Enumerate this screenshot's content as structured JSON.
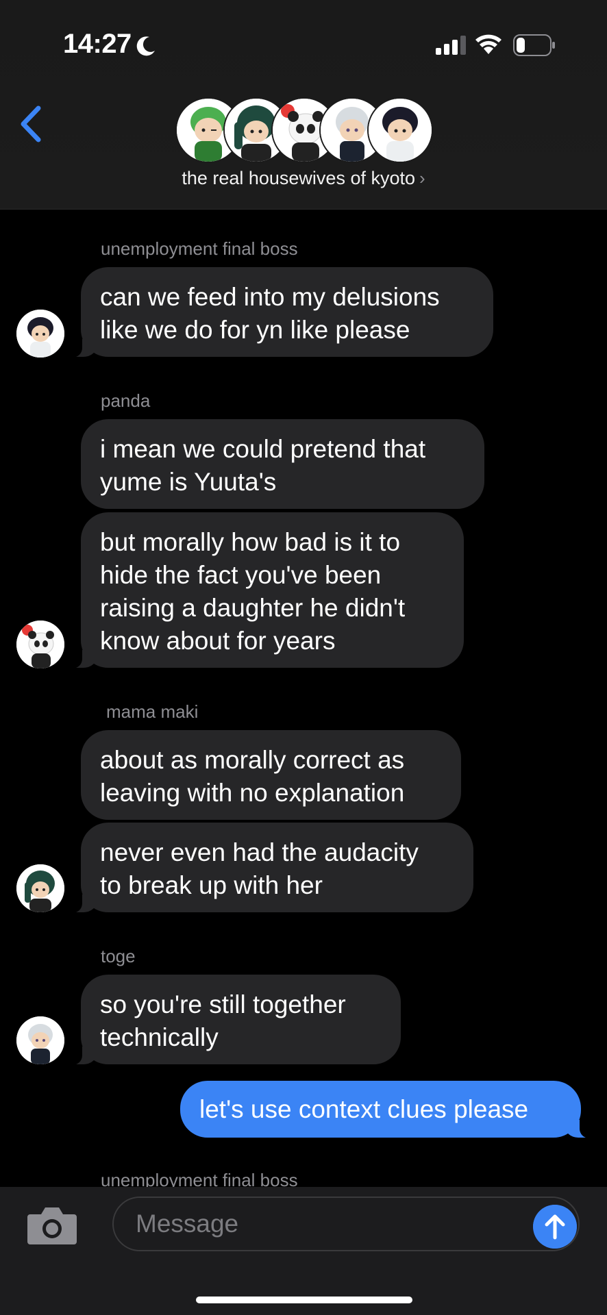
{
  "status_bar": {
    "time": "14:27",
    "icons": [
      "moon-icon",
      "cellular-signal-icon",
      "wifi-icon",
      "battery-icon"
    ]
  },
  "header": {
    "back_icon": "chevron-left-icon",
    "group_name": "the real housewives of kyoto",
    "group_chevron": "›",
    "member_avatars": [
      "green-hair-figure",
      "dark-green-hair-figure",
      "panda-figure",
      "white-hair-figure",
      "black-hair-figure"
    ]
  },
  "messages": {
    "group1": {
      "sender": "unemployment final boss",
      "bubbles": [
        {
          "lines": [
            "can we feed into my delusions",
            "like we do for yn like please"
          ]
        }
      ]
    },
    "group2": {
      "sender": "panda",
      "bubbles": [
        {
          "lines": [
            "i mean we could pretend that",
            "yume is Yuuta's"
          ]
        },
        {
          "lines": [
            "but morally how bad is it to",
            "hide the fact you've been",
            "raising a daughter he didn't",
            "know about for years"
          ]
        }
      ]
    },
    "group3": {
      "sender": "mama maki",
      "bubbles": [
        {
          "lines": [
            "about as morally correct as",
            "leaving with no explanation"
          ]
        },
        {
          "lines": [
            "never even had the audacity",
            "to break up with her"
          ]
        }
      ]
    },
    "group4": {
      "sender": "toge",
      "bubbles": [
        {
          "lines": [
            "so you're still together",
            "technically"
          ]
        }
      ]
    },
    "outgoing": {
      "text": "let's use context clues please"
    },
    "partial_sender": "unemployment final boss"
  },
  "input_bar": {
    "camera_icon": "camera-icon",
    "placeholder": "Message",
    "send_icon": "arrow-up-icon"
  },
  "colors": {
    "background": "#000000",
    "header": "#1c1c1c",
    "incoming_bubble": "#262628",
    "outgoing_bubble": "#3b84f5",
    "accent": "#3b84f5",
    "sender_label": "#8e8e93"
  }
}
